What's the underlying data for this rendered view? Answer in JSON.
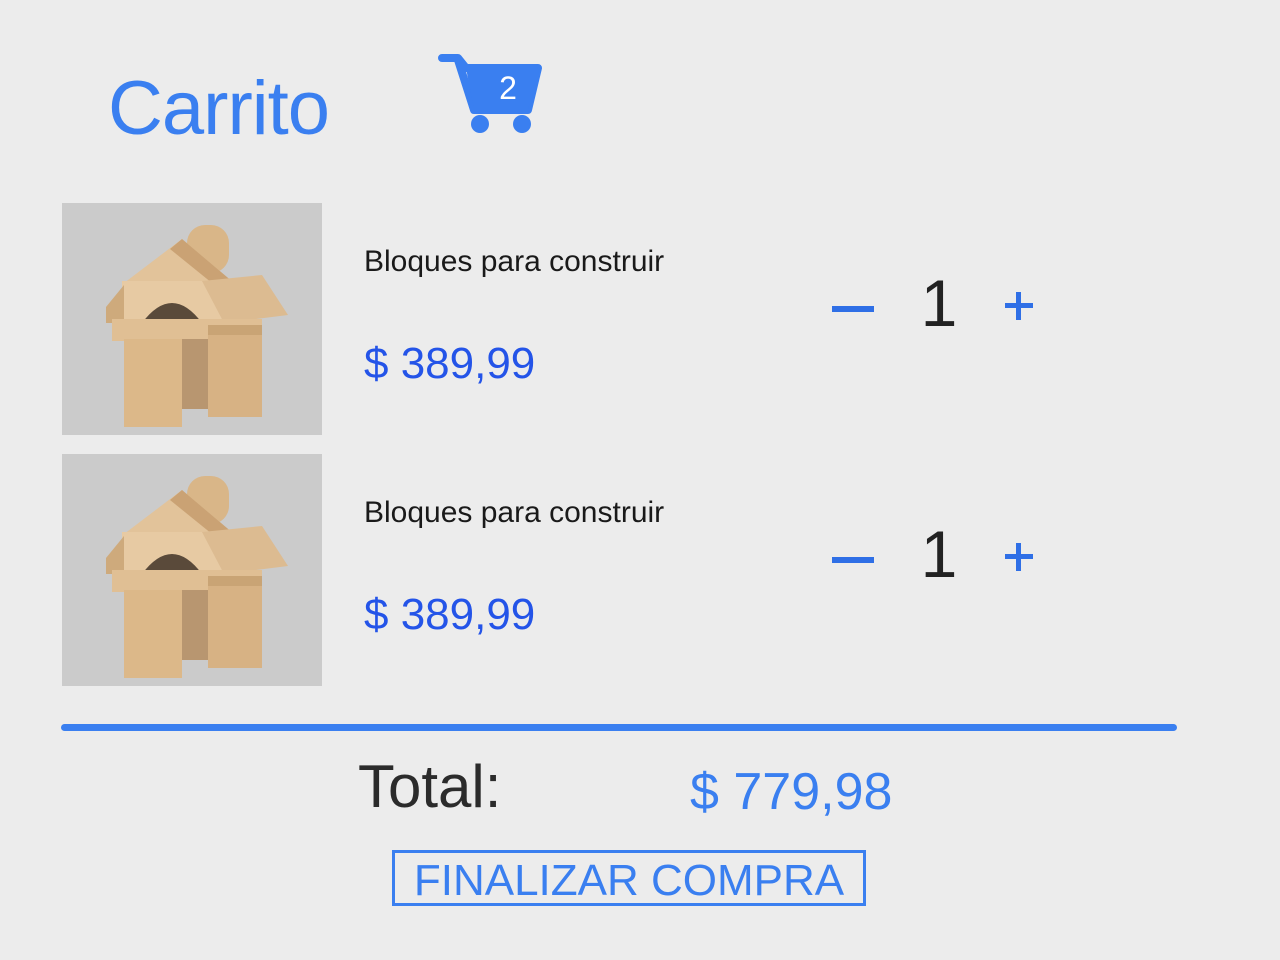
{
  "header": {
    "title": "Carrito",
    "cart_icon": "shopping-cart-icon",
    "cart_count": "2"
  },
  "cart": {
    "items": [
      {
        "image": "wooden-blocks-house",
        "name": "Bloques para construir",
        "price": "$ 389,99",
        "quantity": "1"
      },
      {
        "image": "wooden-blocks-house",
        "name": "Bloques para construir",
        "price": "$ 389,99",
        "quantity": "1"
      }
    ]
  },
  "summary": {
    "total_label": "Total:",
    "total_value": "$ 779,98",
    "checkout_label": "FINALIZAR COMPRA"
  },
  "colors": {
    "accent": "#3a7ff0",
    "price": "#2454e8",
    "background": "#ececec"
  }
}
